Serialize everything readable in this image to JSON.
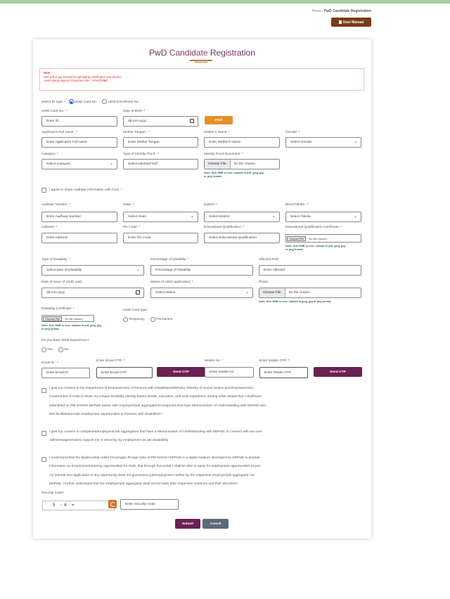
{
  "breadcrumb": {
    "home": "Home",
    "sep": "/",
    "current": "PwD Candidate Registration"
  },
  "user_manual": "User Manual",
  "form": {
    "title_a": "PwD ",
    "title_b": "Candidate",
    "title_c": " Registration",
    "note": {
      "heading": "Note :",
      "line1": "Use pdf or jpg format for uploading certificates and photos.",
      "line2": "Avoid using special characters like \"~!!%!@#$&\"."
    },
    "select_id_type": {
      "label": "Select ID type: *",
      "option1": "UDID Card No.",
      "option2": "UDID Enrollment No."
    },
    "udid_card": {
      "label": "UDID Card No.: *",
      "placeholder": "Enter ID"
    },
    "dob": {
      "label": "Date of Birth: *",
      "value": "dd-mm-yyyy"
    },
    "find_button": "Find",
    "full_name": {
      "label": "Applicant's Full name : *",
      "placeholder": "Enter Applicant's Full name"
    },
    "mother_tongue": {
      "label": "Mother Tongue : *",
      "placeholder": "Enter Mother Tongue"
    },
    "mother_name": {
      "label": "Mother's Name: *",
      "placeholder": "Enter Mother's Name"
    },
    "gender": {
      "label": "Gender: *",
      "value": "Select-Gender"
    },
    "category": {
      "label": "Category: *",
      "value": "Select-Category"
    },
    "identity_type": {
      "label": "Type of Identity Proof : *",
      "value": "Select-IdentityProof"
    },
    "identity_doc": {
      "label": "Identity Proof Document: *",
      "button": "Choose File",
      "file": "No file chosen",
      "hint1": "Note: Size 5MB or less. Upload in pdf, jpeg, jpg",
      "hint2": "or png format."
    },
    "aadhaar_consent": "I agree to share Aadhaar information with Govt. *",
    "aadhaar": {
      "label": "Aadhaar Number: *",
      "placeholder": "Enter Aadhaar Number"
    },
    "state": {
      "label": "State: *",
      "value": "Select-State"
    },
    "district": {
      "label": "District: *",
      "value": "Select-District"
    },
    "taluka": {
      "label": "Block/Taluka : *",
      "value": "Select-Taluka"
    },
    "address": {
      "label": "Address: *",
      "placeholder": "Enter Address"
    },
    "pin": {
      "label": "Pin Code: *",
      "placeholder": "Enter Pin Code"
    },
    "education": {
      "label": "Educational Qualification: *",
      "value": "Select-Educational-Qualification"
    },
    "edu_cert": {
      "label": "Educational Qualification Certificate: *",
      "button": "Choose File",
      "file": "No file chosen",
      "hint1": "Note: Size 5MB or less. Upload in pdf, jpeg, jpg",
      "hint2": "or png format."
    },
    "disability_type": {
      "label": "Type of Disability: *",
      "value": "Select-type-of-Disability"
    },
    "disability_pct": {
      "label": "Percentage of Disability: *",
      "placeholder": "Percentage of Disability"
    },
    "affected_part": {
      "label": "Affected Part:",
      "placeholder": "Enter Affected"
    },
    "udid_issue_date": {
      "label": "Date of issue of UDID card:",
      "value": "dd-mm-yyyy"
    },
    "udid_status": {
      "label": "Status of UDID application: *",
      "value": "Select-Status"
    },
    "photo": {
      "label": "Photo:",
      "button": "Choose File",
      "file": "No file chosen",
      "hint": "Note: Size 5MB or less. Upload in jpeg, jpg or png format."
    },
    "disability_cert": {
      "label": "Disability Certificate: *",
      "button": "Choose File",
      "file": "No file chosen",
      "hint1": "Note: Size 5MB or less. Upload in pdf, jpeg, jpg",
      "hint2": "or png format."
    },
    "udid_card_type": {
      "label": "UDID Card type:",
      "option1": "Temporary",
      "option2": "Permanent"
    },
    "work_experience": {
      "label": "Do you have Work Experience?",
      "yes": "Yes",
      "no": "No"
    },
    "email": {
      "label": "Email ID : *",
      "placeholder": "Enter Email ID"
    },
    "email_otp": {
      "label": "Enter Email OTP: *",
      "placeholder": "Enter Email OTP"
    },
    "send_otp_email": "Send OTP",
    "mobile": {
      "label": "Mobile No. *",
      "placeholder": "Enter Mobile No"
    },
    "mobile_otp": {
      "label": "Enter Mobile OTP: *",
      "placeholder": "Enter Mobile OTP"
    },
    "send_otp_mobile": "Send OTP",
    "consent1": {
      "l1": "I give my consent to the Department of Empowerment of Persons with Disabilities(DEPwD), Ministry of Social Justice and Empowerment,",
      "l2": "Government of India to share my Unique Disability identity based details, education, and work experience among other details that I shall/have",
      "l3": "submit/ted on PM DAKSH-DEPwD portal, with employers/job aggregators/companies that have Memorandum of Understanding with DEPwD and",
      "l4": "that facilitate/provide employment opportunities to Persons with Disabilities *"
    },
    "consent2": {
      "l1": "I give my consent to companies/Employers/Job Aggregators that have a Memorandum of Understanding with DEPwD, to connect with me over",
      "l2": "call/message/email to support me in securing my employment as per availability"
    },
    "consent3": {
      "l1": "I understand that the digital portal called Divyangjan Rozgar Setu of PM DAKSH DEPwD is a digital medium developed by DEPwD to provide",
      "l2": "information on Employment/earning opportunities for PwD, that through this portal I shall be able to apply for employment opportunities as per",
      "l3": "my interest and application to any opportunity does not guarantees job/employment neither by the respective employer/job aggregator nor",
      "l4": "DEPwD. I further understand that the employer/job aggregator shall recruit basis their respective criterions and their discretion*"
    },
    "security": {
      "label": "Security Code*",
      "captcha": "5 -4 =",
      "placeholder": "Enter Security Code"
    },
    "submit": "Submit",
    "cancel": "Cancel"
  }
}
